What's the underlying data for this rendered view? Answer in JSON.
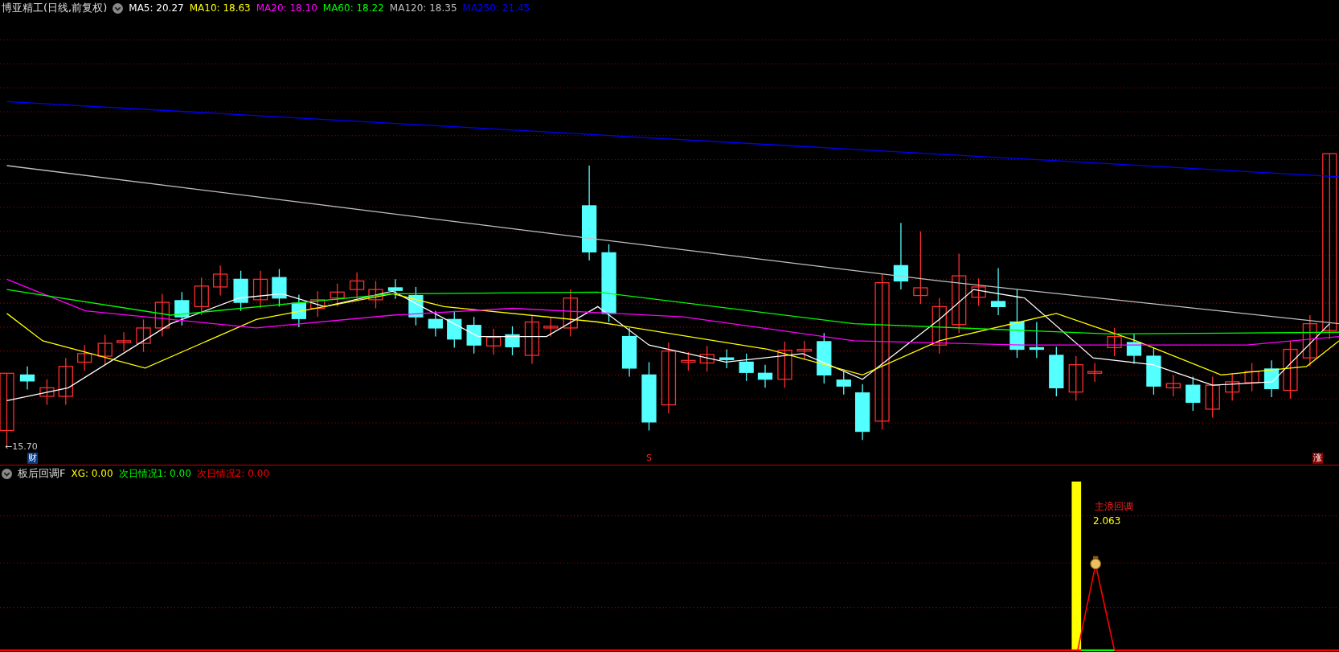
{
  "window": {
    "title": "博亚精工(日线,前复权)"
  },
  "main_chart": {
    "indicators": [
      {
        "label": "MA5: 20.27",
        "color": "#ffffff"
      },
      {
        "label": "MA10: 18.63",
        "color": "#ffff00"
      },
      {
        "label": "MA20: 18.10",
        "color": "#ff00ff"
      },
      {
        "label": "MA60: 18.22",
        "color": "#00ff00"
      },
      {
        "label": "MA120: 18.35",
        "color": "#c0c0c0"
      },
      {
        "label": "MA250: 21.45",
        "color": "#0000ff"
      }
    ],
    "price_label": "←15.70",
    "markers": [
      {
        "text": "财",
        "kind": "finance"
      },
      {
        "text": "S",
        "kind": "signal"
      },
      {
        "text": "涨",
        "kind": "limit_up"
      }
    ]
  },
  "sub_chart": {
    "title": "板后回调F",
    "indicators": [
      {
        "label": "XG: 0.00",
        "color": "#ffff00"
      },
      {
        "label": "次日情况1: 0.00",
        "color": "#00ff00"
      },
      {
        "label": "次日情况2: 0.00",
        "color": "#ff0000"
      }
    ],
    "annotation": "主浪回调",
    "value": "2.063"
  }
}
